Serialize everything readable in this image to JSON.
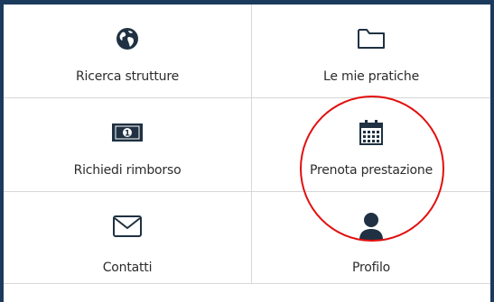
{
  "menu": {
    "items": [
      {
        "label": "Ricerca strutture",
        "icon": "globe-icon"
      },
      {
        "label": "Le mie pratiche",
        "icon": "folder-icon"
      },
      {
        "label": "Richiedi rimborso",
        "icon": "banknote-icon"
      },
      {
        "label": "Prenota prestazione",
        "icon": "calendar-icon"
      },
      {
        "label": "Contatti",
        "icon": "envelope-icon"
      },
      {
        "label": "Profilo",
        "icon": "user-icon"
      }
    ]
  },
  "colors": {
    "icon": "#1f3142",
    "annotation": "#e20f0f",
    "border": "#d7d7d7",
    "frame": "#1c3a5c"
  }
}
